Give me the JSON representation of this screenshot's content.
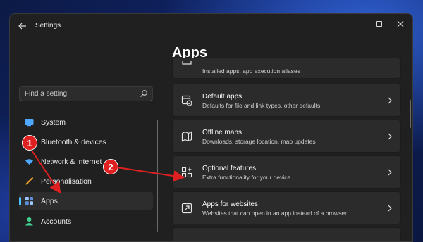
{
  "window": {
    "title": "Settings"
  },
  "search": {
    "placeholder": "Find a setting"
  },
  "sidebar": {
    "items": [
      {
        "label": "System",
        "icon": "monitor-icon"
      },
      {
        "label": "Bluetooth & devices",
        "icon": "bluetooth-icon"
      },
      {
        "label": "Network & internet",
        "icon": "wifi-icon"
      },
      {
        "label": "Personalisation",
        "icon": "brush-icon"
      },
      {
        "label": "Apps",
        "icon": "apps-icon",
        "selected": true
      },
      {
        "label": "Accounts",
        "icon": "person-icon"
      }
    ]
  },
  "main": {
    "title": "Apps",
    "partial_card": {
      "subtitle": "Installed apps, app execution aliases"
    },
    "cards": [
      {
        "title": "Default apps",
        "subtitle": "Defaults for file and link types, other defaults",
        "icon": "default-apps-icon"
      },
      {
        "title": "Offline maps",
        "subtitle": "Downloads, storage location, map updates",
        "icon": "map-icon"
      },
      {
        "title": "Optional features",
        "subtitle": "Extra functionality for your device",
        "icon": "optional-features-icon"
      },
      {
        "title": "Apps for websites",
        "subtitle": "Websites that can open in an app instead of a browser",
        "icon": "web-link-icon"
      }
    ]
  },
  "annotations": [
    {
      "number": "1"
    },
    {
      "number": "2"
    }
  ],
  "colors": {
    "accent": "#4cc2ff",
    "annotation": "#e02020",
    "window_bg": "#202020",
    "card_bg": "#2b2b2b"
  }
}
